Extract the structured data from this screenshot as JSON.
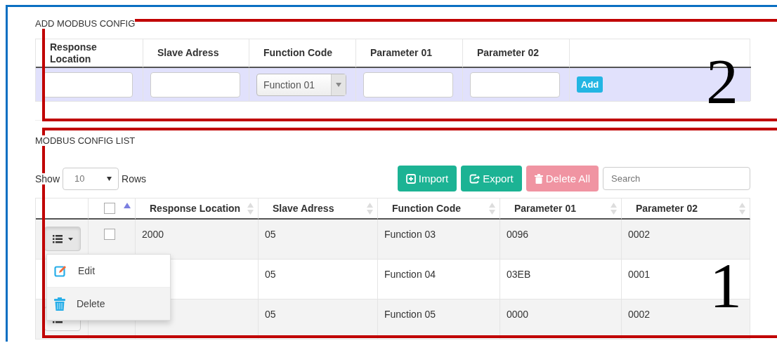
{
  "add_form": {
    "title": "ADD MODBUS CONFIG",
    "annotation": "2",
    "columns": [
      "Response Location",
      "Slave Adress",
      "Function Code",
      "Parameter 01",
      "Parameter 02"
    ],
    "fields": [
      {
        "kind": "text"
      },
      {
        "kind": "text"
      },
      {
        "kind": "select",
        "value": "Function 01"
      },
      {
        "kind": "text"
      },
      {
        "kind": "text"
      }
    ],
    "add_button": "Add"
  },
  "list": {
    "title": "MODBUS CONFIG LIST",
    "annotation": "1",
    "show_label": "Show",
    "page_size": "10",
    "rows_label": "Rows",
    "buttons": [
      {
        "label": "Import",
        "kind": "import",
        "disabled": false
      },
      {
        "label": "Export",
        "kind": "export",
        "disabled": false
      },
      {
        "label": "Delete All",
        "kind": "delete",
        "disabled": true
      }
    ],
    "search": {
      "placeholder": "Search"
    },
    "select_all": {
      "checked": false
    },
    "columns": [
      "Response Location",
      "Slave Adress",
      "Function Code",
      "Parameter 01",
      "Parameter 02"
    ],
    "rows": [
      {
        "action_button": true,
        "checked": false,
        "menu_open": true,
        "response_location": "2000",
        "slave_address": "05",
        "function_code": "Function 03",
        "parameter_01": "0096",
        "parameter_02": "0002"
      },
      {
        "action_button": false,
        "menu_open": false,
        "slave_address": "05",
        "function_code": "Function 04",
        "parameter_01": "03EB",
        "parameter_02": "0001"
      },
      {
        "action_button": true,
        "menu_open": false,
        "slave_address": "05",
        "function_code": "Function 05",
        "parameter_01": "0000",
        "parameter_02": "0002"
      }
    ],
    "menu": [
      {
        "label": "Edit",
        "kind": "edit",
        "selected": false
      },
      {
        "label": "Delete",
        "kind": "delete",
        "selected": true
      }
    ]
  }
}
